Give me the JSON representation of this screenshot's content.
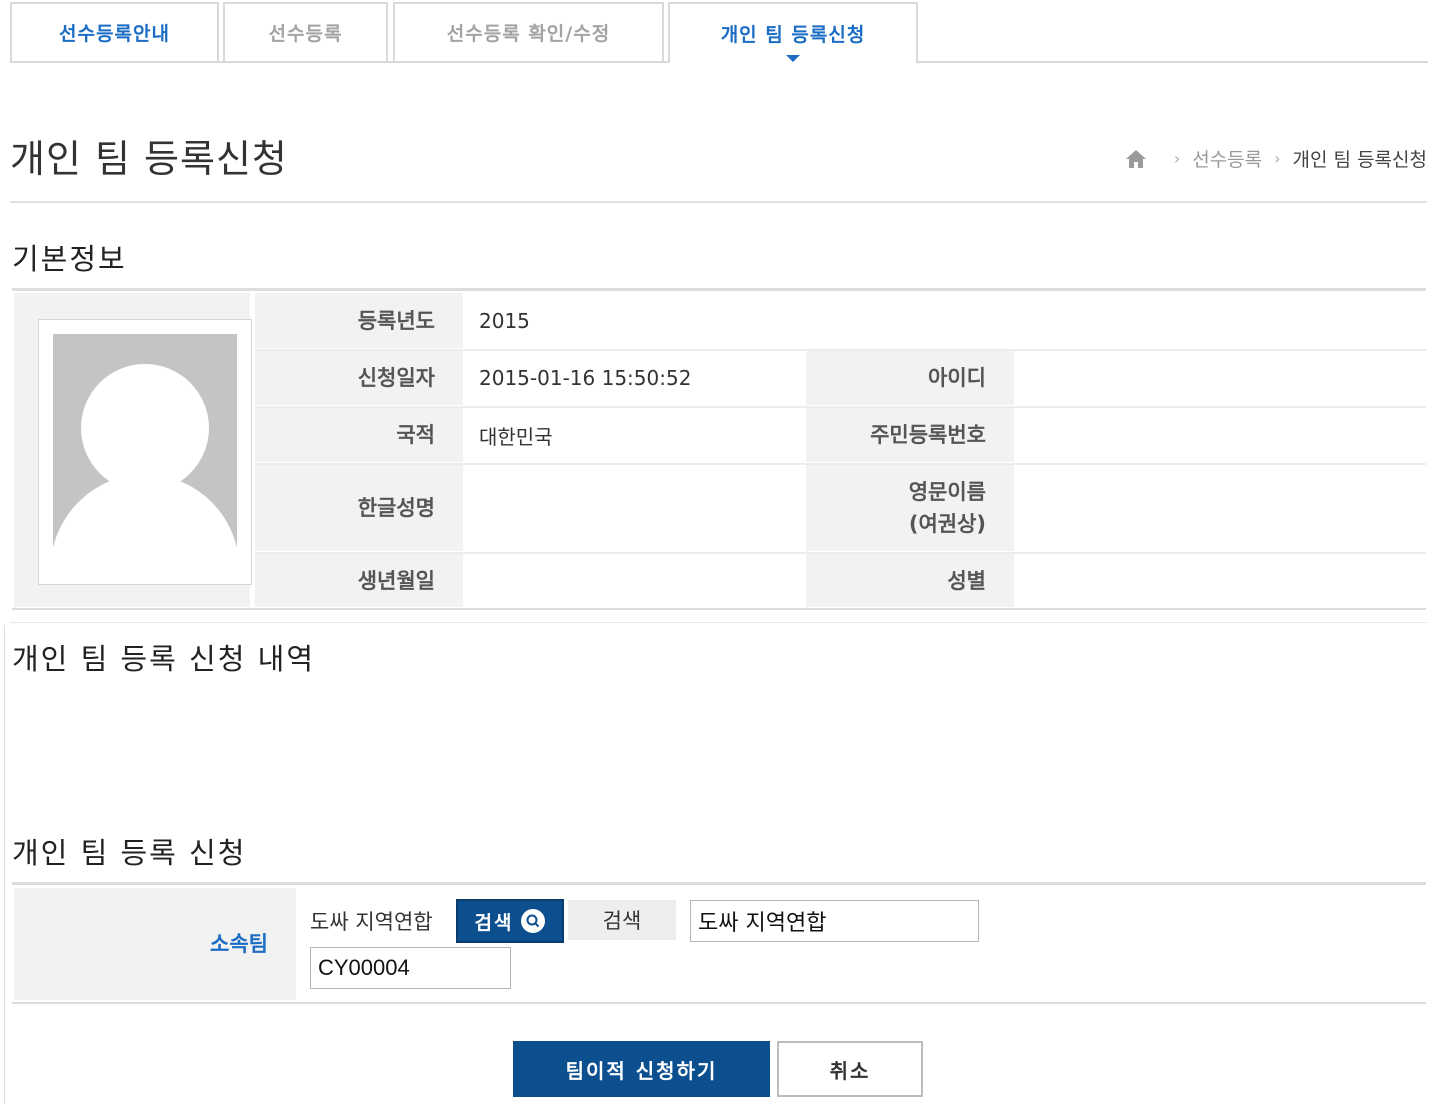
{
  "tabs": [
    {
      "label": "선수등록안내"
    },
    {
      "label": "선수등록"
    },
    {
      "label": "선수등록 확인/수정"
    },
    {
      "label": "개인 팀 등록신청"
    }
  ],
  "header": {
    "title": "개인 팀 등록신청",
    "breadcrumb": [
      "선수등록",
      "개인 팀 등록신청"
    ]
  },
  "basic": {
    "title": "기본정보",
    "labels": {
      "year": "등록년도",
      "applied": "신청일자",
      "id": "아이디",
      "nationality": "국적",
      "rrn": "주민등록번호",
      "korean_name": "한글성명",
      "english_name_1": "영문이름",
      "english_name_2": "(여권상)",
      "birth": "생년월일",
      "gender": "성별"
    },
    "values": {
      "year": "2015",
      "applied": "2015-01-16 15:50:52",
      "id": "",
      "nationality": "대한민국",
      "rrn": "",
      "korean_name": "",
      "english_name": "",
      "birth": "",
      "gender": ""
    }
  },
  "history": {
    "title": "개인 팀 등록 신청 내역"
  },
  "apply": {
    "title": "개인 팀 등록 신청",
    "team_label": "소속팀",
    "team_name": "도싸 지역연합",
    "search_button": "검색",
    "search_label": "검색",
    "team_name_input": "도싸 지역연합",
    "team_code_input": "CY00004"
  },
  "actions": {
    "submit": "팀이적 신청하기",
    "cancel": "취소"
  },
  "colors": {
    "accent": "#0b4f8e",
    "tab_active": "#1a6cc4"
  }
}
